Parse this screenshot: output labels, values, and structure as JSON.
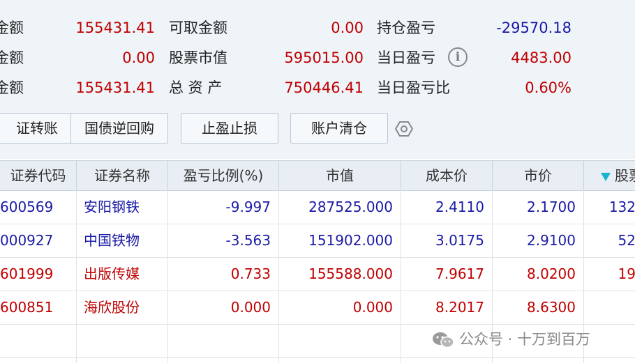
{
  "summary": {
    "col1": [
      {
        "label": "金额",
        "value": "155431.41"
      },
      {
        "label": "金额",
        "value": "0.00"
      },
      {
        "label": "金额",
        "value": "155431.41"
      }
    ],
    "col2": [
      {
        "label": "可取金额",
        "value": "0.00"
      },
      {
        "label": "股票市值",
        "value": "595015.00"
      },
      {
        "label": "总 资 产",
        "value": "750446.41"
      }
    ],
    "col3": [
      {
        "label": "持仓盈亏",
        "value": "-29570.18"
      },
      {
        "label": "当日盈亏",
        "value": "4483.00"
      },
      {
        "label": "当日盈亏比",
        "value": "0.60%"
      }
    ],
    "info_icon_glyph": "i"
  },
  "toolbar": {
    "transfer": "证转账",
    "reverse_repo": "国债逆回购",
    "take_profit_stop_loss": "止盈止损",
    "clear_account": "账户清仓"
  },
  "table": {
    "columns": [
      "证券代码",
      "证券名称",
      "盈亏比例(%)",
      "市值",
      "成本价",
      "市价",
      "股票"
    ],
    "rows": [
      {
        "code": "600569",
        "name": "安阳钢铁",
        "pnl_pct": "-9.997",
        "market_value": "287525.000",
        "cost": "2.4110",
        "price": "2.1700",
        "extra": "132",
        "tone": "blue"
      },
      {
        "code": "000927",
        "name": "中国铁物",
        "pnl_pct": "-3.563",
        "market_value": "151902.000",
        "cost": "3.0175",
        "price": "2.9100",
        "extra": "52",
        "tone": "blue"
      },
      {
        "code": "601999",
        "name": "出版传媒",
        "pnl_pct": "0.733",
        "market_value": "155588.000",
        "cost": "7.9617",
        "price": "8.0200",
        "extra": "19",
        "tone": "red"
      },
      {
        "code": "600851",
        "name": "海欣股份",
        "pnl_pct": "0.000",
        "market_value": "0.000",
        "cost": "8.2017",
        "price": "8.6300",
        "extra": "",
        "tone": "red"
      }
    ]
  },
  "watermark": {
    "text": "公众号 · 十万到百万"
  },
  "colors": {
    "red": "#c00000",
    "blue": "#1a1aa6",
    "header_bg": "#e8eef3",
    "summary_bg": "#eef4f8",
    "sort_icon": "#13b5d0"
  }
}
